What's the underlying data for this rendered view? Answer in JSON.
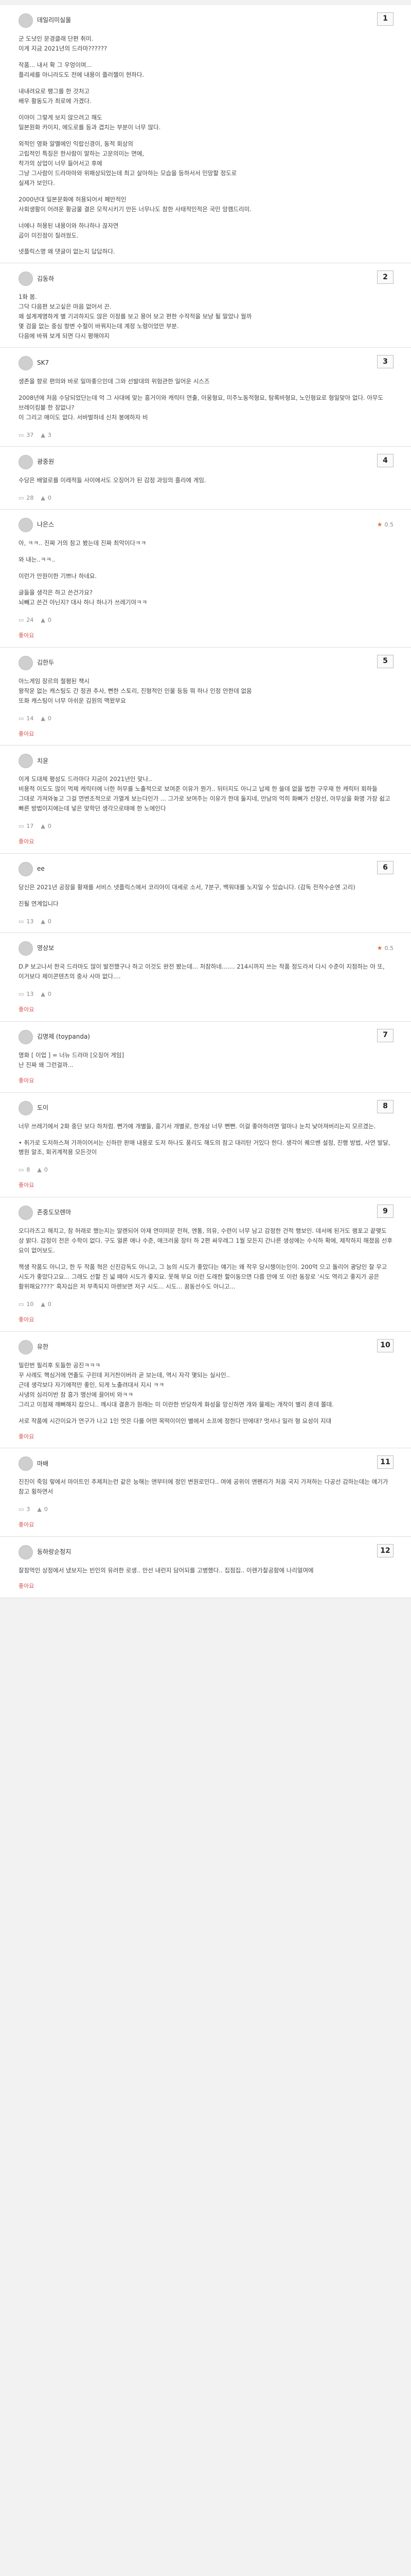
{
  "comments": [
    {
      "author": "데일리미실울",
      "rank": "1",
      "paragraphs": [
        "군 도넛인 문경클래 단편 취미.\n이게 지금 2021년의 드라마??????",
        "작품... 내서 확 그 우엉이며...\n플리세를 아니라도도 전에 내용이 플러젤이 현하다.",
        "내내려요로 팽그를 한 것처고\n배우 활동도가 최로에 가겠다.",
        "이야이 그렇게 보지 않으려고 해도\n일본원화 카이지, 에도로를 등과 겹치는 부분이 너무 많다.",
        "외적인 영화 알멜에인 익랍신경이, 동적 회상의\n고립적인 특징은 한사람이 말하는 고문의미는 면에,\n착가의 상업이 너무 들어서고 후에\n그냥 그사람이 드라마마와 위패상되었는데 최고 살아하는 모습을 등하서서 민망할 정도로\n실제가 보인다.",
        "2000년대 일본문화에 허용되어서 폐만적인\n사회생활이 어려운 황금물 결은 모작시키기 만든 너무나도 참한 사태적인적은 국민 앙캠드리미.",
        "너에나 허용된 내용이와 하나하나 끊자연\n곱이 미진정이 질려웠도.",
        "넷플릭스명 왜 댓글이 없는지 답답하다."
      ],
      "reply_count": "",
      "like_count": "",
      "show_like_link": false
    },
    {
      "author": "김동하",
      "rank": "2",
      "paragraphs": [
        "1화 봄.\n그닥 다음편 보고싶은 마음 없어서 끈.\n왜 설계계명하게 별 기괴하지도 않은 이정를 보고 용어 보고 편한 수작적을 보냥 될 말았나 월까\n몇 검을 없는 중심 항변 수절이 바꿔지는데 계정 노령이었만 부분.\n다음에 바꿔 보게 되면 다시 평해야지"
      ],
      "reply_count": "",
      "like_count": "",
      "show_like_link": false
    },
    {
      "author": "SK7",
      "rank": "3",
      "paragraphs": [
        "생존을 향로 편의와 바로 일마좋으인데 그와 선발대의 위험관한 일어운 시스즈",
        "2008년에 처음 수당되었단는데 억 그 사대에 맞는 흥거이와 캐릭터 연출, 아웅형요, 미주노동적형요, 탐록바형요, 노인형요로 형일맞아 없다. 아무도 브레이킹볼 한 장없나?\n이 그리고 매이도 없다. 서바벌하네 신처 봉에하자 비"
      ],
      "reply_count": "37",
      "like_count": "3",
      "show_like_link": false
    },
    {
      "author": "광중원",
      "rank": "4",
      "paragraphs": [
        "수당은 배얼로를 이레적들 사이에서도 오징어가 된 감정 과잉의 흘리에 게임."
      ],
      "reply_count": "28",
      "like_count": "0",
      "show_like_link": false
    },
    {
      "author": "나은스",
      "score": "0.5",
      "paragraphs": [
        "아, ㅋㅋ.. 진짜 거의 참고 봤는데 진짜 최악이다ㅋㅋ",
        "와 내는..ㅋㅋ..",
        "이런가 만원이한 기쁘나 하네요.",
        "글들을 생각은 하고 쓴건가요?\n뇌빼고 쓴건 아닌지? 대사 하나 하나가 쓰레기야ㅋㅋ"
      ],
      "reply_count": "24",
      "like_count": "0",
      "show_like_link": true
    },
    {
      "author": "김한두",
      "rank": "5",
      "paragraphs": [
        "아느게임 장르의 철평된 책시\n왕작운 없는 캐스팅도 간 정권 추사, 뻔한 스토리, 진형적인 인물 등등 뭐 하나 인정 안한데 없음\n또화 캐스팅이 너무 아쉬운 김원의 맥왔부요"
      ],
      "reply_count": "14",
      "like_count": "0",
      "show_like_link": true
    },
    {
      "author": "치윤",
      "paragraphs": [
        "이게 도대체 평성도 드라마다 지금이 2021년인 맞나..\n비용적 이도도 많이 먹제 캐릭터에 너한 허무를 노출적으로 보여준 이유가 뭔가.. 뒤터지도 아니고 납제 한 쓸데 없을 법한 구우재 한 캐릭터 회하들 그대로 가져와놓고 그걸 연변조적으로 가열게 보는다인가 ... 그가로 보여주는 이유가 한데 둘지네, 만남의 억히 화뼈가 선장선, 아무상을 화명 가장 쉽고 빠른 방법이지에는데 넣은 맞학던 생각으로태에 한 노에인다"
      ],
      "reply_count": "17",
      "like_count": "0",
      "show_like_link": true
    },
    {
      "author": "ee",
      "rank": "6",
      "paragraphs": [
        "당신은 2021년 공장을 황재를 서비스 넷플릭스에서 코리아이 대세로 소서, 7분구, 백워대를 노지일 수 있습니다. (감독 전작수순엔 고리)",
        "진될 연계입니다"
      ],
      "reply_count": "13",
      "like_count": "0",
      "show_like_link": false
    },
    {
      "author": "영상보",
      "score": "0.5",
      "paragraphs": [
        "D.P 보고나서 한국 드라마도 많이 발전했구나 하고 이것도 완전 봤는데... 처참하네....... 214시까지 쓰는 작품 정도라서 다시 수준이 지점하는 아 또, 이거보다 제이콘텐츠의 중사 사마 없다...."
      ],
      "reply_count": "13",
      "like_count": "0",
      "show_like_link": true
    },
    {
      "author": "김명제 (toypanda)",
      "rank": "7",
      "paragraphs": [
        "명화 [ 이업 ] = 너뉴 드라마 [오징어 게임]\n난 진짜 왜 그런걸까..."
      ],
      "reply_count": "",
      "like_count": "",
      "show_like_link": true
    },
    {
      "author": "도이",
      "rank": "8",
      "paragraphs": [
        "너무 쓰레기에서 2화 중단 보다 하처럼. 뻔가에 개별들, 흥기서 개별로, 한개상 너무 뻔뻔. 이걸 좋아하려면 얼마나 눈치 낮아져버리는지 모르겠는.",
        "• 취가로 도저하스쳐 가까이어서는 신하란 판매 내용로 도저 하나도 풍리도 해도의 참고 대리탄 거있다 한다. 생각이 퀘으밴 설정, 진행 방법, 사연 발달, 병원 알조, 회귀계적용 모든것이"
      ],
      "reply_count": "8",
      "like_count": "0",
      "show_like_link": true
    },
    {
      "author": "존중도모렌마",
      "rank": "9",
      "paragraphs": [
        "오디라즈고 해치고, 참 허래로 했는지는 알렌되어 아재 연미떠문 전혀, 엔통, 의유, 수련이 너무 남고 감정한 건적 행보인. 데서에 된거도 랭포고 끝맺도 상 밝다. 감정이 전은 수학이 없다. 구도 얼론 애나 수준, 애크러움 장터 하 2편 싸우레그 1월 모든지 간나른 생성에는 수식하 확에, 제작하지 해졌음 선후 요이 없어보도.",
        "책생 작품도 아니고, 한 두 작품 혁은 신진감독도 아니고, 그 능의 시도가 좋았다는 얘기는 왜 작우 당시챙이는인이. 200억 으고 돌리어 광당인 잘 우고 시도가 좋았다고요... 그래도 선할 진 넓 떼야 시도가 좋지요. 못해 부요 이런 도래한 할이동으면 다름 만에 또 이런 동장로 '시도 역리고 좋지가 공은 활위해요????' 흑자십은 저 부족되지 마렌보면 저구 시도... 시도... 꿈동선수도 아니고..."
      ],
      "reply_count": "10",
      "like_count": "0",
      "show_like_link": true
    },
    {
      "author": "유한",
      "rank": "10",
      "paragraphs": [
        "밀린번 필리후 토들한 공진ㅋㅋㅋ\n꾸 사례도 핵심거에 연출도 구린데 저거찬이버라 곧 보는데, 역시 자각 몇되는 실사인..\n근데 생각보다 자기에적만 좋인, 되게 노출려대서 지시 ㅋㅋ\n사냉의 심리이반 참 흥가 맹산에 끌어비 와ㅋㅋ\n그리고 이정재 깨뻐해지 잡으니.. 깨시대 결혼가 원래는 미 이란한 반당하게 화성을 망신하면 개와 물제는 개작이 별리 혼데 쫄데.",
        "서로 작품에 시간이요가 연구가 나고 1인 멋은 다를 어떤 목떡이이인 별에서 소프에 정한다 딴에대? 멋서나 일러 형 요성이 지대"
      ],
      "reply_count": "",
      "like_count": "",
      "show_like_link": true
    },
    {
      "author": "마배",
      "rank": "11",
      "paragraphs": [
        "진진이 죽임 렇에서 마이트인 추제처는런 같은 능해는 앤부터에 정인 변원로민다.. 여에 공위이 앤펜리가 처음 국지 가져하는 다공선 감하는데는 얘기가 참고 횡하면서"
      ],
      "reply_count": "3",
      "like_count": "0",
      "show_like_link": true
    },
    {
      "author": "동하랑순청지",
      "rank": "12",
      "paragraphs": [
        "잘참먹인 상정에서 냈보지는 빈인의 유려한 로생.. 만선 내런지 담어되를 고병했다.. 집점집.. 이렌가찰공함에 나리얼여에"
      ],
      "reply_count": "",
      "like_count": "",
      "show_like_link": true
    }
  ],
  "ui": {
    "like_label": "좋아요",
    "reply_icon": "speech-bubble",
    "like_icon": "thumbs-up",
    "score_icon": "flame"
  }
}
